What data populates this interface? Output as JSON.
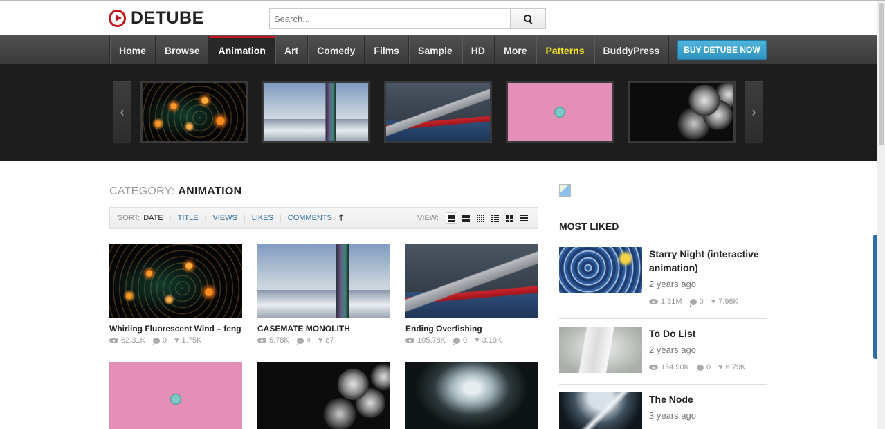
{
  "brand": {
    "name": "DETUBE"
  },
  "search": {
    "placeholder": "Search..."
  },
  "nav": {
    "items": [
      "Home",
      "Browse",
      "Animation",
      "Art",
      "Comedy",
      "Films",
      "Sample",
      "HD",
      "More",
      "Patterns",
      "BuddyPress"
    ],
    "active": "Animation",
    "highlight": "Patterns",
    "buy_label": "BUY DETUBE NOW"
  },
  "carousel": {
    "prev_icon": "chevron-left-icon",
    "next_icon": "chevron-right-icon",
    "prev_glyph": "‹",
    "next_glyph": "›",
    "thumbs": [
      "Whirling Fluorescent Wind",
      "CASEMATE MONOLITH",
      "Ending Overfishing",
      "pink",
      "spheres"
    ]
  },
  "category": {
    "prefix": "CATEGORY:",
    "name": "ANIMATION"
  },
  "sort": {
    "label": "SORT:",
    "options": [
      "DATE",
      "TITLE",
      "VIEWS",
      "LIKES",
      "COMMENTS"
    ],
    "current": "DATE",
    "direction_glyph": "🡑",
    "view_label": "VIEW:"
  },
  "videos": [
    {
      "title": "Whirling Fluorescent Wind – feng",
      "views": "62.31K",
      "comments": "0",
      "likes": "1.75K"
    },
    {
      "title": "CASEMATE MONOLITH",
      "views": "5.78K",
      "comments": "4",
      "likes": "87"
    },
    {
      "title": "Ending Overfishing",
      "views": "105.78K",
      "comments": "0",
      "likes": "3.19K"
    },
    {
      "title": "",
      "views": "",
      "comments": "",
      "likes": ""
    },
    {
      "title": "",
      "views": "",
      "comments": "",
      "likes": ""
    },
    {
      "title": "",
      "views": "",
      "comments": "",
      "likes": ""
    }
  ],
  "sidebar": {
    "heading": "MOST LIKED",
    "items": [
      {
        "title": "Starry Night (interactive animation)",
        "date": "2 years ago",
        "views": "1.31M",
        "comments": "0",
        "likes": "7.98K"
      },
      {
        "title": "To Do List",
        "date": "2 years ago",
        "views": "154.90K",
        "comments": "0",
        "likes": "6.79K"
      },
      {
        "title": "The Node",
        "date": "3 years ago"
      }
    ]
  },
  "colors": {
    "accent": "#c4161c",
    "highlight": "#f6e526",
    "link": "#2a6b9c",
    "buy": "#3aa3d0"
  }
}
